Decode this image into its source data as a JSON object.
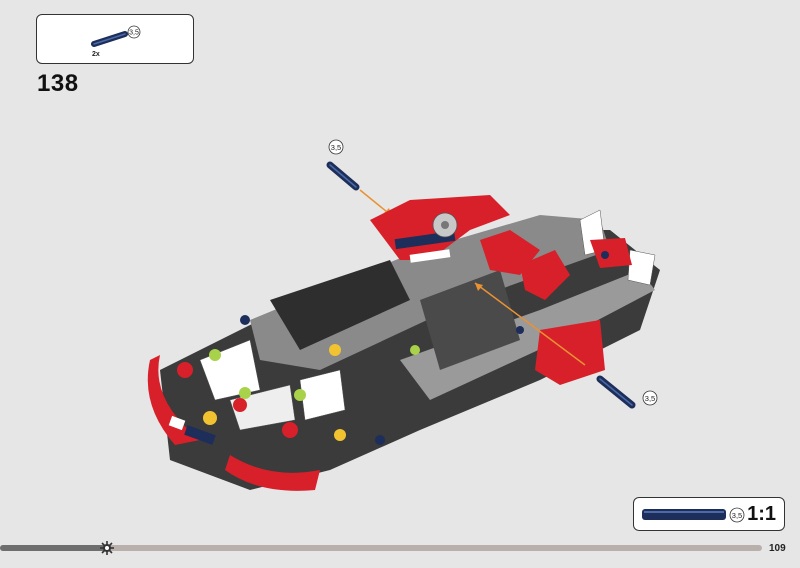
{
  "parts_callout": {
    "quantity": "2x",
    "part_length": "3,5",
    "part_icon": "axle-connector-pin-icon"
  },
  "step": {
    "number": "138"
  },
  "model": {
    "icon": "technic-car-chassis-assembly",
    "pin_length_label_top": "3,5",
    "pin_length_label_bottom": "3,5",
    "colors": {
      "red": "#d8202a",
      "dark_gray": "#3b3b3b",
      "mid_gray": "#8a8a8a",
      "white": "#ffffff",
      "navy": "#1d2e5a",
      "lime": "#a8d24a",
      "yellow": "#f2c330",
      "arrow": "#e89233"
    }
  },
  "scale": {
    "part_length": "3,5",
    "ratio": "1:1"
  },
  "progress": {
    "fraction": 0.14,
    "marker_icon": "gear-icon"
  },
  "page": {
    "number": "109"
  }
}
